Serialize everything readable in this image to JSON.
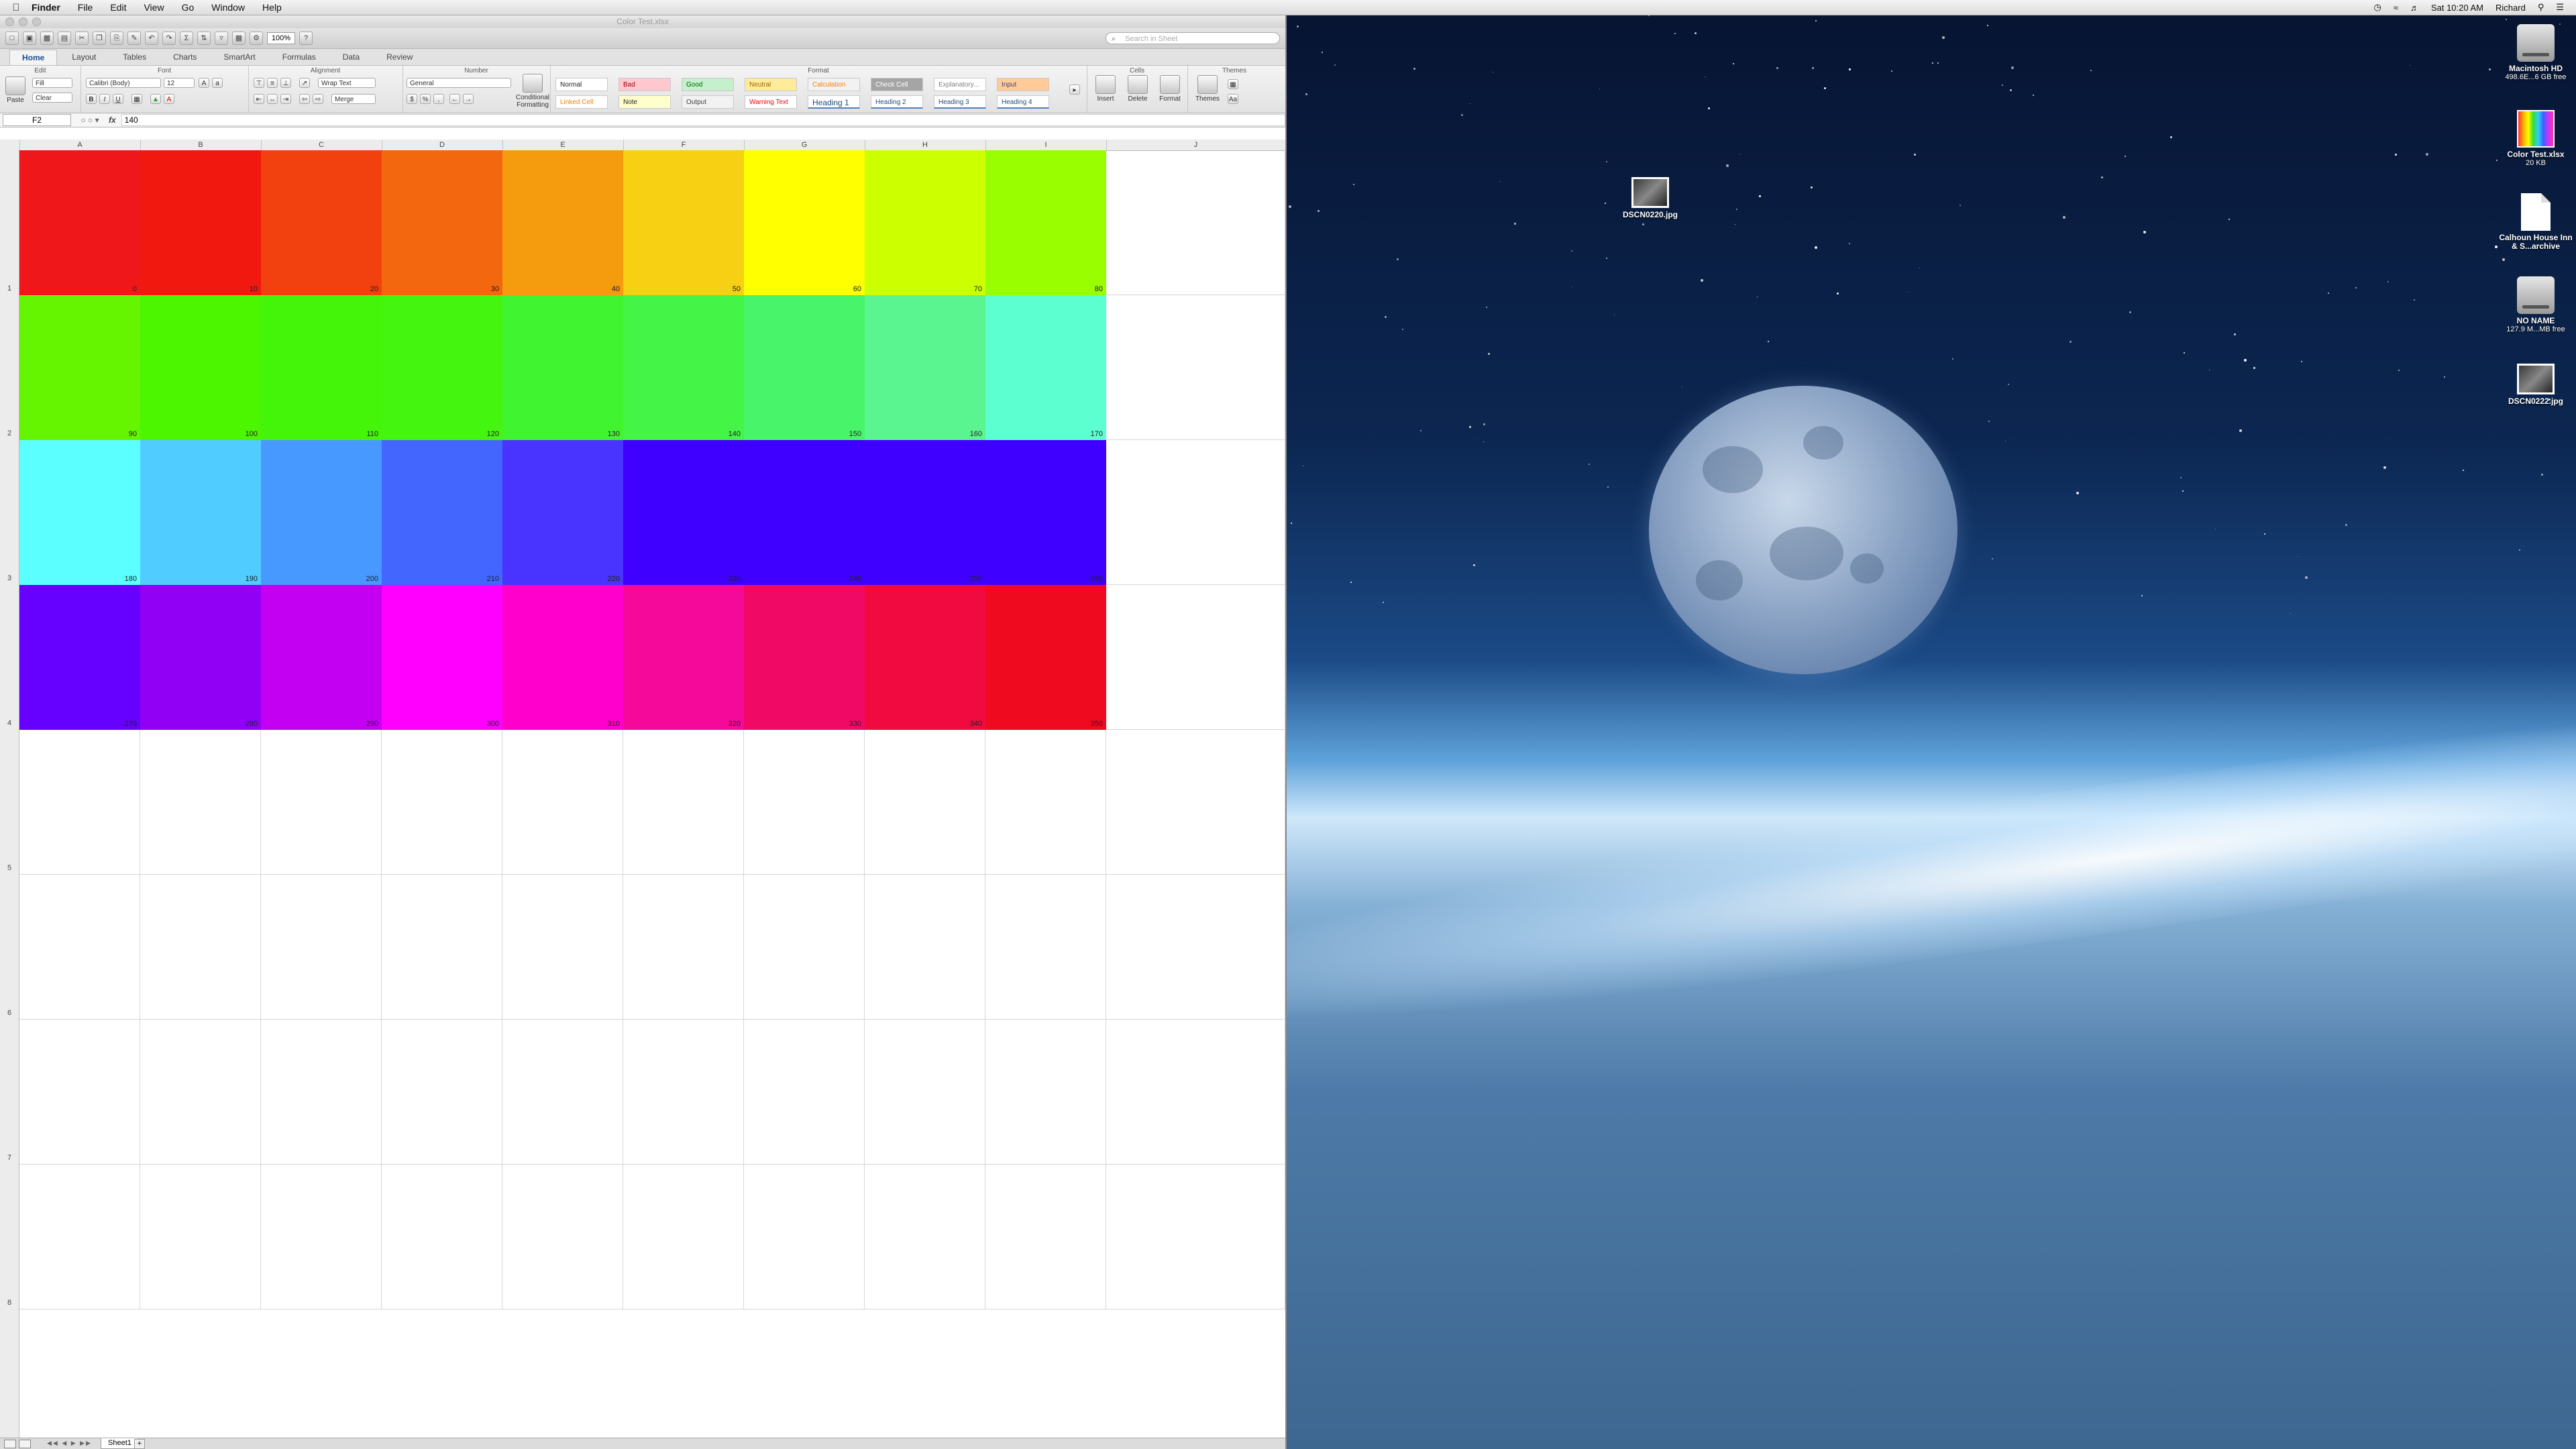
{
  "menubar": {
    "apple": "",
    "items": [
      "Finder",
      "File",
      "Edit",
      "View",
      "Go",
      "Window",
      "Help"
    ],
    "clock": "Sat 10:20 AM",
    "user": "Richard"
  },
  "window": {
    "title": "Color Test.xlsx",
    "zoom": "100%",
    "search_placeholder": "Search in Sheet"
  },
  "ribbon_tabs": [
    "Home",
    "Layout",
    "Tables",
    "Charts",
    "SmartArt",
    "Formulas",
    "Data",
    "Review"
  ],
  "ribbon": {
    "groups": {
      "edit": "Edit",
      "font": "Font",
      "alignment": "Alignment",
      "number": "Number",
      "format": "Format",
      "cells": "Cells",
      "themes": "Themes"
    },
    "paste": "Paste",
    "fill": "Fill",
    "clear": "Clear",
    "font_name": "Calibri (Body)",
    "font_size": "12",
    "wrap_text": "Wrap Text",
    "merge": "Merge",
    "number_format": "General",
    "conditional_formatting": "Conditional Formatting",
    "insert": "Insert",
    "delete": "Delete",
    "format": "Format",
    "themes": "Themes",
    "styles": [
      {
        "label": "Normal",
        "bg": "#ffffff",
        "fg": "#222222"
      },
      {
        "label": "Bad",
        "bg": "#ffc7ce",
        "fg": "#9c0006"
      },
      {
        "label": "Good",
        "bg": "#c6efce",
        "fg": "#006100"
      },
      {
        "label": "Neutral",
        "bg": "#ffeb9c",
        "fg": "#9c6500"
      },
      {
        "label": "Calculation",
        "bg": "#f2f2f2",
        "fg": "#fa7d00"
      },
      {
        "label": "Check Cell",
        "bg": "#a5a5a5",
        "fg": "#ffffff"
      },
      {
        "label": "Explanatory...",
        "bg": "#ffffff",
        "fg": "#7f7f7f"
      },
      {
        "label": "Input",
        "bg": "#ffcc99",
        "fg": "#3f3f76"
      },
      {
        "label": "Linked Cell",
        "bg": "#ffffff",
        "fg": "#fa7d00"
      },
      {
        "label": "Note",
        "bg": "#ffffcc",
        "fg": "#222222"
      },
      {
        "label": "Output",
        "bg": "#f2f2f2",
        "fg": "#3f3f3f"
      },
      {
        "label": "Warning Text",
        "bg": "#ffffff",
        "fg": "#ff0000"
      },
      {
        "label": "Heading 1",
        "bg": "#ffffff",
        "fg": "#1f497d"
      },
      {
        "label": "Heading 2",
        "bg": "#ffffff",
        "fg": "#1f497d"
      },
      {
        "label": "Heading 3",
        "bg": "#ffffff",
        "fg": "#1f497d"
      },
      {
        "label": "Heading 4",
        "bg": "#ffffff",
        "fg": "#1f497d"
      }
    ]
  },
  "formula": {
    "name_box": "F2",
    "value": "140",
    "fx": "fx"
  },
  "columns": [
    "A",
    "B",
    "C",
    "D",
    "E",
    "F",
    "G",
    "H",
    "I",
    "J"
  ],
  "rows": [
    "1",
    "2",
    "3",
    "4",
    "5",
    "6",
    "7",
    "8"
  ],
  "cells": [
    [
      {
        "v": "0",
        "c": "#f0171a"
      },
      {
        "v": "10",
        "c": "#f1190f"
      },
      {
        "v": "20",
        "c": "#f2400f"
      },
      {
        "v": "30",
        "c": "#f3680e"
      },
      {
        "v": "40",
        "c": "#f49c0e"
      },
      {
        "v": "50",
        "c": "#f7cf13"
      },
      {
        "v": "60",
        "c": "#ffff00"
      },
      {
        "v": "70",
        "c": "#ccff00"
      },
      {
        "v": "80",
        "c": "#99ff00"
      }
    ],
    [
      {
        "v": "90",
        "c": "#66f500"
      },
      {
        "v": "100",
        "c": "#4cf500"
      },
      {
        "v": "110",
        "c": "#44f50a"
      },
      {
        "v": "120",
        "c": "#44f510"
      },
      {
        "v": "130",
        "c": "#40f530"
      },
      {
        "v": "140",
        "c": "#44f548"
      },
      {
        "v": "150",
        "c": "#48f56a"
      },
      {
        "v": "160",
        "c": "#5af590"
      },
      {
        "v": "170",
        "c": "#5cffcf"
      }
    ],
    [
      {
        "v": "180",
        "c": "#5cffff"
      },
      {
        "v": "190",
        "c": "#50ccff"
      },
      {
        "v": "200",
        "c": "#4899ff"
      },
      {
        "v": "210",
        "c": "#4266ff"
      },
      {
        "v": "220",
        "c": "#4833ff"
      },
      {
        "v": "230",
        "c": "#3f00ff"
      },
      {
        "v": "240",
        "c": "#3f00ff"
      },
      {
        "v": "250",
        "c": "#3f00ff"
      },
      {
        "v": "260",
        "c": "#3f00ff"
      }
    ],
    [
      {
        "v": "270",
        "c": "#6600ff"
      },
      {
        "v": "280",
        "c": "#9100f5"
      },
      {
        "v": "290",
        "c": "#c400f2"
      },
      {
        "v": "300",
        "c": "#ff00ff"
      },
      {
        "v": "310",
        "c": "#ff00cc"
      },
      {
        "v": "320",
        "c": "#f5099a"
      },
      {
        "v": "330",
        "c": "#f00a66"
      },
      {
        "v": "340",
        "c": "#f00a40"
      },
      {
        "v": "350",
        "c": "#f00a20"
      }
    ]
  ],
  "sheet_tab": "Sheet1",
  "desktop_icons": [
    {
      "name": "Macintosh HD",
      "sub": "498.6E...6 GB free",
      "kind": "hd"
    },
    {
      "name": "Color Test.xlsx",
      "sub": "20 KB",
      "kind": "xls"
    },
    {
      "name": "Calhoun House Inn & S...archive",
      "sub": "",
      "kind": "doc"
    },
    {
      "name": "NO NAME",
      "sub": "127.9 M...MB free",
      "kind": "hd"
    },
    {
      "name": "DSCN0222.jpg",
      "sub": "",
      "kind": "photo"
    }
  ],
  "desktop_photo_icon": {
    "name": "DSCN0220.jpg"
  }
}
